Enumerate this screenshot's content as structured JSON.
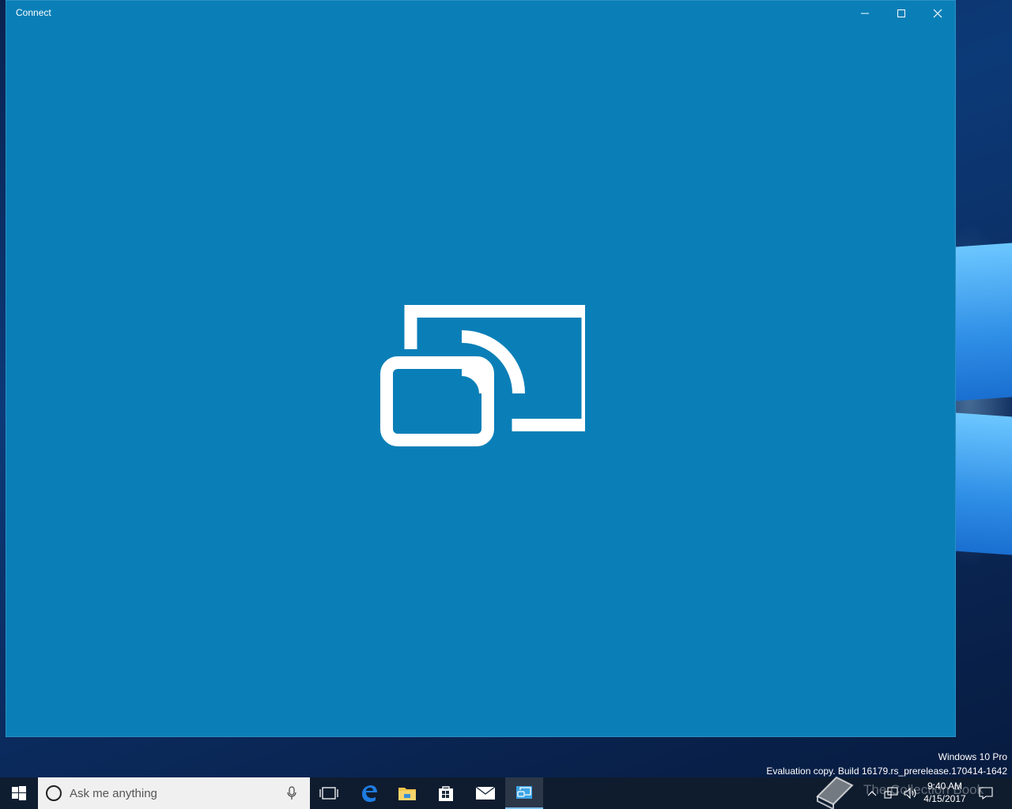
{
  "window": {
    "title": "Connect",
    "controls": {
      "minimize": "minimize-icon",
      "maximize": "maximize-icon",
      "close": "close-icon"
    },
    "background_color": "#0a7fb7"
  },
  "hero_icon": "project-to-screen-icon",
  "watermark": {
    "line1": "Windows 10 Pro",
    "line2": "Evaluation copy. Build 16179.rs_prerelease.170414-1642"
  },
  "taskbar": {
    "search_placeholder": "Ask me anything",
    "pinned": [
      "task-view-icon",
      "edge-icon",
      "file-explorer-icon",
      "store-icon",
      "mail-icon",
      "connect-app-icon"
    ],
    "clock_time": "9:40 AM",
    "clock_date": "4/15/2017",
    "stamp_text": "The Collection Book"
  }
}
